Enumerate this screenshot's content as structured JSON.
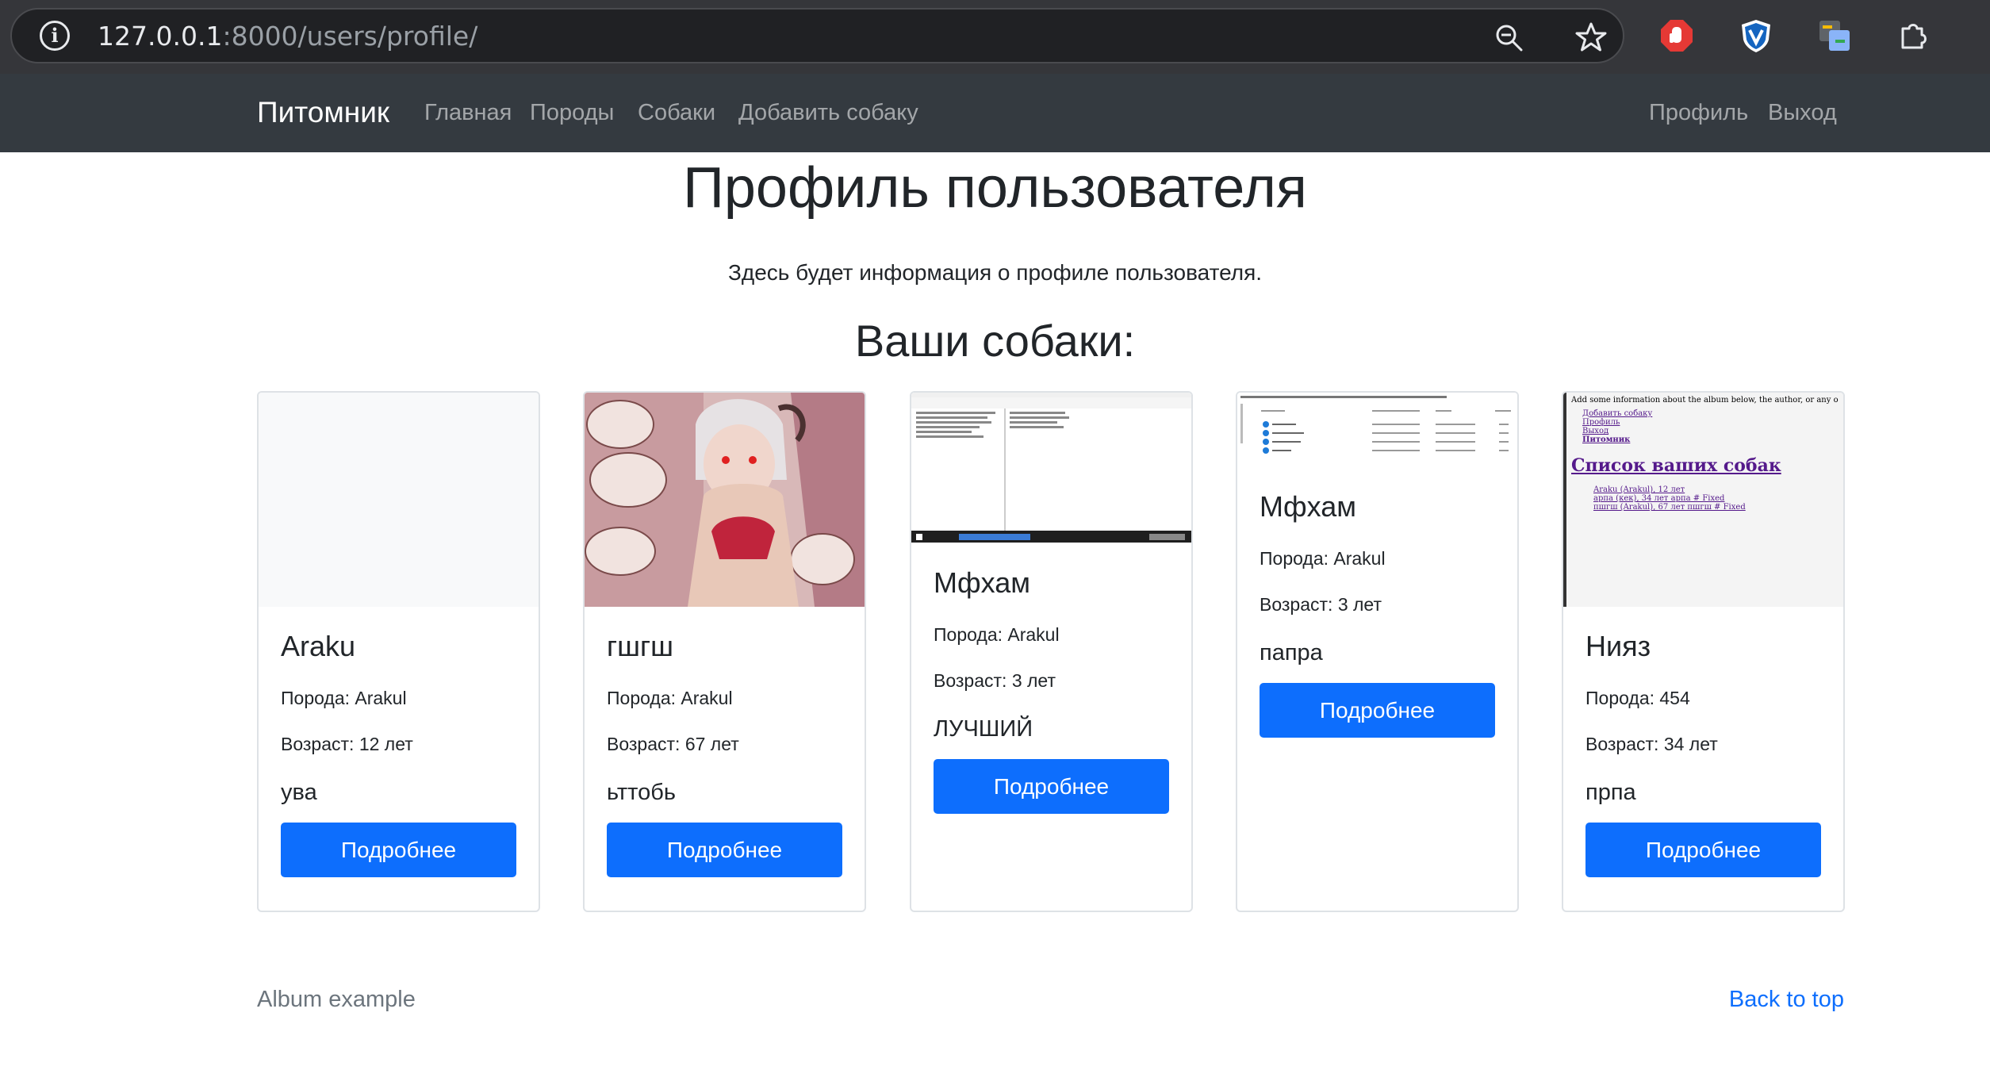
{
  "browser": {
    "url_host": "127.0.0.1",
    "url_rest": ":8000/users/profile/"
  },
  "navbar": {
    "brand": "Питомник",
    "links": [
      "Главная",
      "Породы",
      "Собаки",
      "Добавить собаку"
    ],
    "right_links": [
      "Профиль",
      "Выход"
    ]
  },
  "main": {
    "title": "Профиль пользователя",
    "lead": "Здесь будет информация о профиле пользователя.",
    "section_title": "Ваши собаки:"
  },
  "cards": [
    {
      "name": "Araku",
      "breed": "Порода: Arakul",
      "age": "Возраст: 12 лет",
      "desc": "ува",
      "button": "Подробнее",
      "image": "blank"
    },
    {
      "name": "гшгш",
      "breed": "Порода: Arakul",
      "age": "Возраст: 67 лет",
      "desc": "ьттобь",
      "button": "Подробнее",
      "image": "anime-illustration"
    },
    {
      "name": "Мфхам",
      "breed": "Порода: Arakul",
      "age": "Возраст: 3 лет",
      "desc": "ЛУЧШИЙ",
      "button": "Подробнее",
      "image": "desktop-screenshot"
    },
    {
      "name": "Мфхам",
      "breed": "Порода: Arakul",
      "age": "Возраст: 3 лет",
      "desc": "папра",
      "button": "Подробнее",
      "image": "file-explorer-screenshot"
    },
    {
      "name": "Нияз",
      "breed": "Порода: 454",
      "age": "Возраст: 34 лет",
      "desc": "прпа",
      "button": "Подробнее",
      "image": "webpage-screenshot"
    }
  ],
  "thumb_webpage": {
    "line1": "Add some information about the album below, the author, or any o",
    "links": [
      "Добавить собаку",
      "Профиль",
      "Выход"
    ],
    "brand": "Питомник",
    "heading": "Список ваших собак",
    "items": [
      "Araku (Arakul), 12 лет",
      "арпа (кек), 34 лет арпа # Fixed",
      "пшгш (Arakul), 67 лет пшгш # Fixed"
    ]
  },
  "footer": {
    "left": "Album example",
    "right": "Back to top"
  },
  "colors": {
    "navbar_bg": "#343a40",
    "primary": "#0d6efd",
    "chrome_bg": "#35363a"
  }
}
